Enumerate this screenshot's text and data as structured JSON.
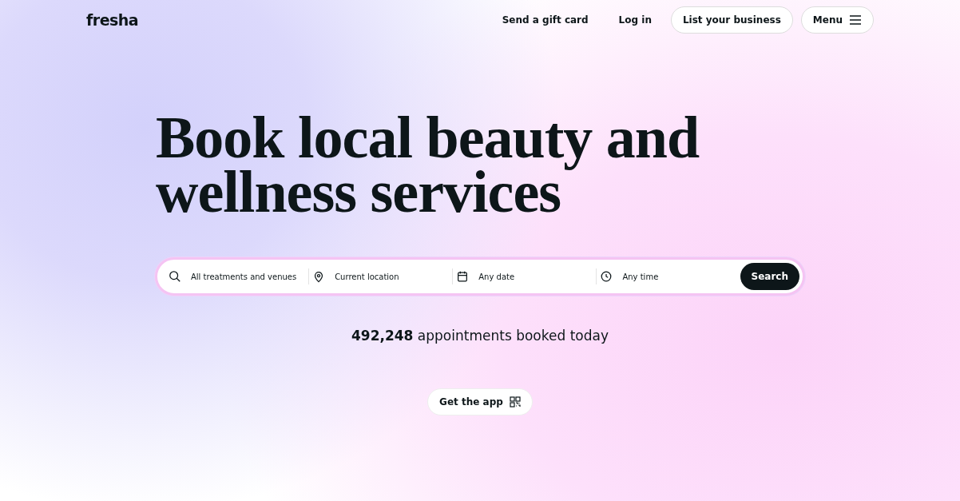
{
  "header": {
    "logo": "fresha",
    "links": [
      "Send a gift card",
      "Log in"
    ],
    "list_business": "List your business",
    "menu": "Menu"
  },
  "headline": {
    "lines": [
      "Book local beauty and",
      "wellness services"
    ]
  },
  "search": {
    "fields": [
      {
        "kind": "search",
        "placeholder": "All treatments and venues"
      },
      {
        "kind": "location",
        "placeholder": "Current location"
      },
      {
        "kind": "date",
        "placeholder": "Any date"
      },
      {
        "kind": "time",
        "placeholder": "Any time"
      }
    ],
    "button": "Search"
  },
  "stats": "**492,248** appointments booked today",
  "app_button": "Get the app"
}
